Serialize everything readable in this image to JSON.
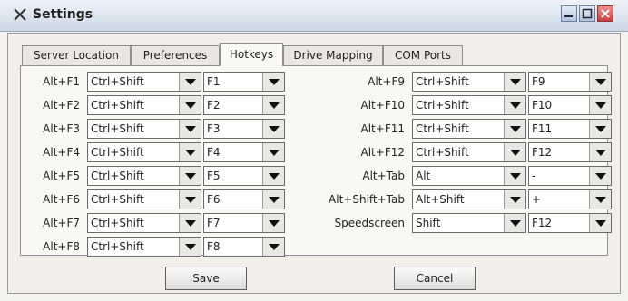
{
  "window": {
    "title": "Settings",
    "icon": "x-app-icon"
  },
  "tabs": [
    {
      "label": "Server Location",
      "active": false
    },
    {
      "label": "Preferences",
      "active": false
    },
    {
      "label": "Hotkeys",
      "active": true
    },
    {
      "label": "Drive Mapping",
      "active": false
    },
    {
      "label": "COM Ports",
      "active": false
    }
  ],
  "hotkeys_left": [
    {
      "label": "Alt+F1",
      "modifier": "Ctrl+Shift",
      "key": "F1"
    },
    {
      "label": "Alt+F2",
      "modifier": "Ctrl+Shift",
      "key": "F2"
    },
    {
      "label": "Alt+F3",
      "modifier": "Ctrl+Shift",
      "key": "F3"
    },
    {
      "label": "Alt+F4",
      "modifier": "Ctrl+Shift",
      "key": "F4"
    },
    {
      "label": "Alt+F5",
      "modifier": "Ctrl+Shift",
      "key": "F5"
    },
    {
      "label": "Alt+F6",
      "modifier": "Ctrl+Shift",
      "key": "F6"
    },
    {
      "label": "Alt+F7",
      "modifier": "Ctrl+Shift",
      "key": "F7"
    },
    {
      "label": "Alt+F8",
      "modifier": "Ctrl+Shift",
      "key": "F8"
    }
  ],
  "hotkeys_right": [
    {
      "label": "Alt+F9",
      "modifier": "Ctrl+Shift",
      "key": "F9"
    },
    {
      "label": "Alt+F10",
      "modifier": "Ctrl+Shift",
      "key": "F10"
    },
    {
      "label": "Alt+F11",
      "modifier": "Ctrl+Shift",
      "key": "F11"
    },
    {
      "label": "Alt+F12",
      "modifier": "Ctrl+Shift",
      "key": "F12"
    },
    {
      "label": "Alt+Tab",
      "modifier": "Alt",
      "key": "-"
    },
    {
      "label": "Alt+Shift+Tab",
      "modifier": "Alt+Shift",
      "key": "+"
    },
    {
      "label": "Speedscreen",
      "modifier": "Shift",
      "key": "F12"
    }
  ],
  "buttons": {
    "save": "Save",
    "cancel": "Cancel"
  },
  "colors": {
    "titlebar": "#cdd8e6",
    "close_button": "#d05050"
  }
}
